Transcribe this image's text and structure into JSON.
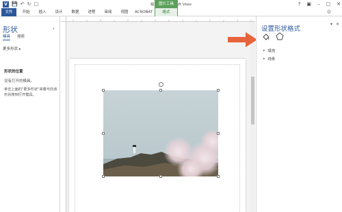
{
  "titlebar": {
    "app_logo": "V",
    "title": "绘图1 - Microsoft Visio",
    "contextual_group": "图片工具",
    "qat_icons": [
      "save-icon",
      "undo-icon",
      "redo-icon",
      "new-document-icon"
    ]
  },
  "ribbon": {
    "tabs": [
      "文件",
      "开始",
      "插入",
      "设计",
      "数据",
      "进程",
      "审阅",
      "视图",
      "ACROBAT",
      "格式"
    ],
    "active_tab": "格式"
  },
  "shapes_pane": {
    "title": "形状",
    "tabs": [
      "模具",
      "搜索"
    ],
    "more_shapes": "更多形状",
    "heading": "形状的位置",
    "message": "没有打开的模具。",
    "hint": "单击上面的\"更多形状\"来着可向该形状搜到打开模具。"
  },
  "format_pane": {
    "title": "设置形状格式",
    "sections": [
      "填充",
      "线条"
    ]
  },
  "colors": {
    "brand": "#2b579a",
    "context": "#5ca05c",
    "arrow": "#e8643c"
  }
}
